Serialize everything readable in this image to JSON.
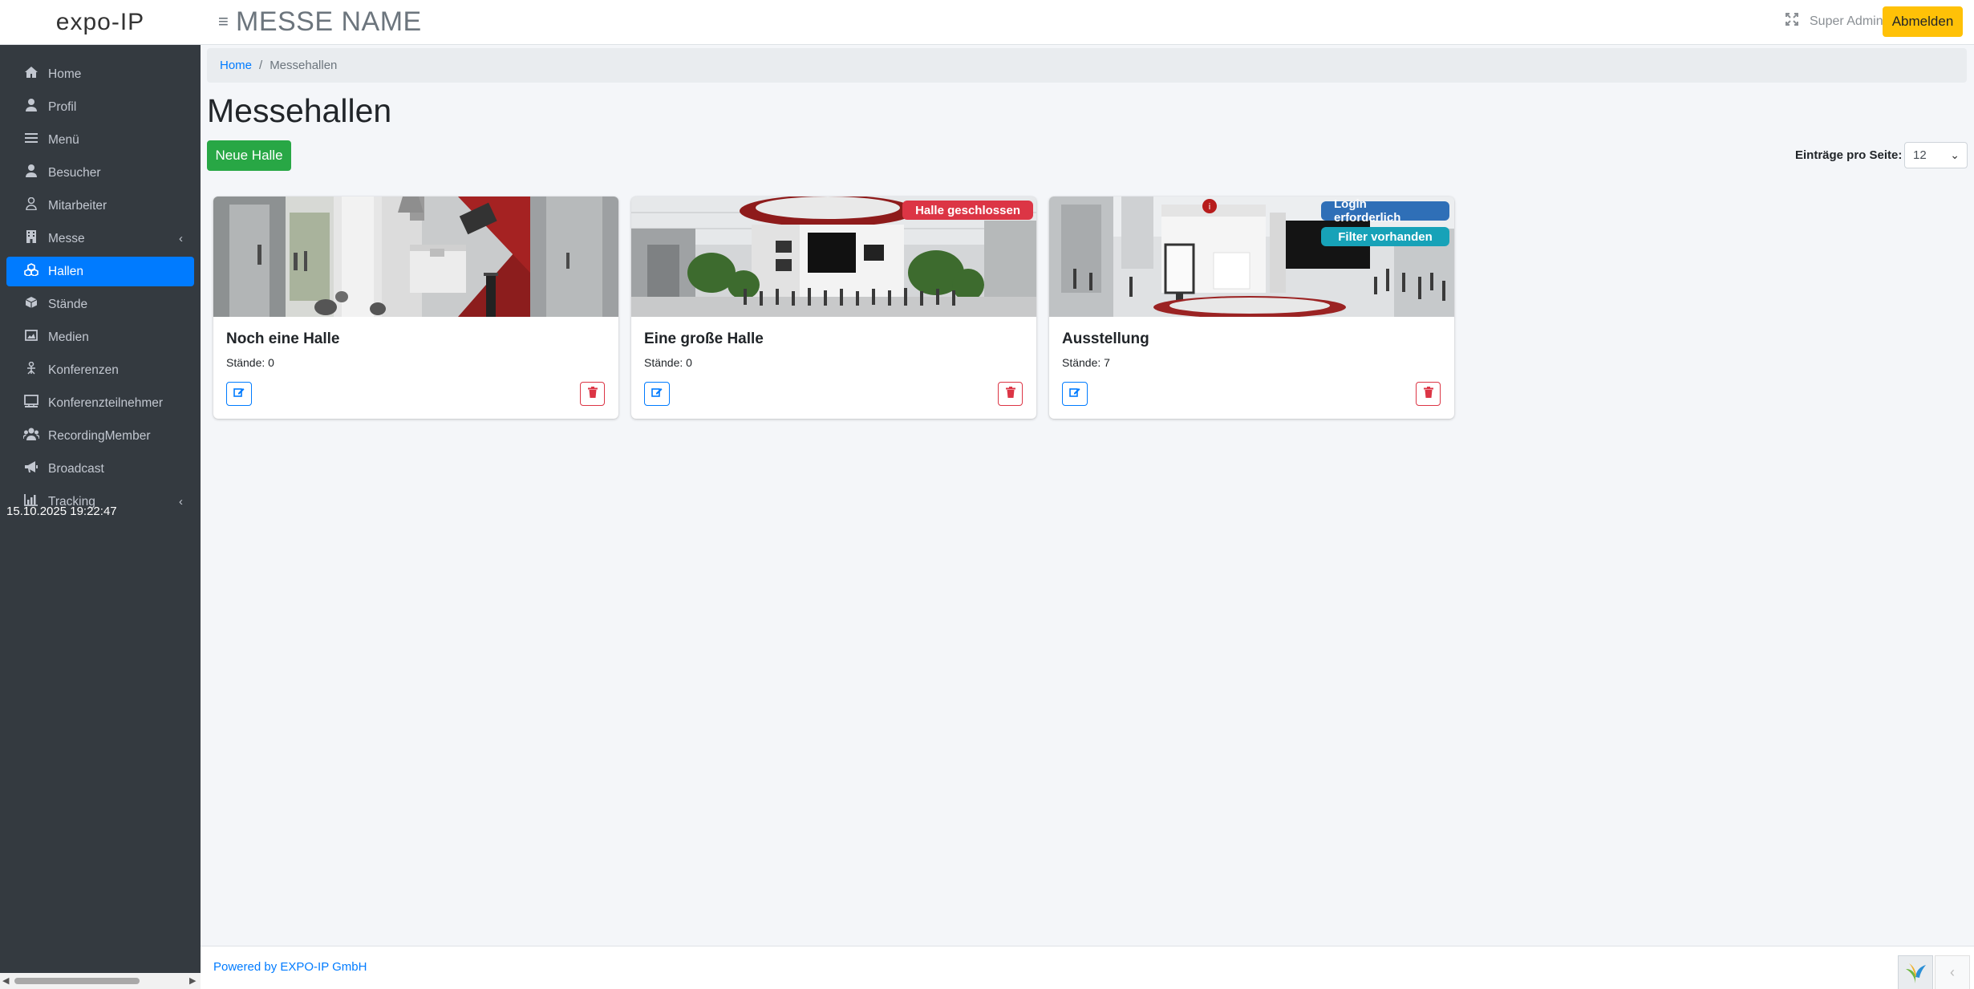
{
  "header": {
    "brand": "expo-IP",
    "app_title": "MESSE NAME",
    "user_name": "Super Admin",
    "logout_label": "Abmelden"
  },
  "sidebar": {
    "items": [
      {
        "label": "Home",
        "icon": "home-icon"
      },
      {
        "label": "Profil",
        "icon": "user-icon"
      },
      {
        "label": "Menü",
        "icon": "list-icon"
      },
      {
        "label": "Besucher",
        "icon": "user-icon"
      },
      {
        "label": "Mitarbeiter",
        "icon": "user-tie-icon"
      },
      {
        "label": "Messe",
        "icon": "building-icon",
        "expandable": true
      },
      {
        "label": "Hallen",
        "icon": "cubes-icon",
        "active": true
      },
      {
        "label": "Stände",
        "icon": "cube-icon"
      },
      {
        "label": "Medien",
        "icon": "image-icon"
      },
      {
        "label": "Konferenzen",
        "icon": "chalkboard-teacher-icon"
      },
      {
        "label": "Konferenzteilnehmer",
        "icon": "chalkboard-icon"
      },
      {
        "label": "RecordingMember",
        "icon": "users-icon"
      },
      {
        "label": "Broadcast",
        "icon": "bullhorn-icon"
      },
      {
        "label": "Tracking",
        "icon": "chart-icon",
        "expandable": true
      }
    ],
    "clock": "15.10.2025 19:22:47"
  },
  "breadcrumb": {
    "home": "Home",
    "current": "Messehallen"
  },
  "page": {
    "title": "Messehallen",
    "new_button": "Neue Halle",
    "per_page_label": "Einträge pro Seite:",
    "per_page_value": "12"
  },
  "cards": [
    {
      "title": "Noch eine Halle",
      "stands": "Stände: 0",
      "badges": []
    },
    {
      "title": "Eine große Halle",
      "stands": "Stände: 0",
      "badges": [
        "Halle geschlossen"
      ]
    },
    {
      "title": "Ausstellung",
      "stands": "Stände: 7",
      "badges": [
        "Login erforderlich",
        "Filter vorhanden"
      ]
    }
  ],
  "footer": {
    "powered_by": "Powered by EXPO-IP GmbH"
  },
  "colors": {
    "sidebar_bg": "#343a40",
    "active": "#007bff",
    "success": "#28a745",
    "warning": "#ffc107",
    "danger": "#dc3545",
    "info": "#17a2b8"
  }
}
